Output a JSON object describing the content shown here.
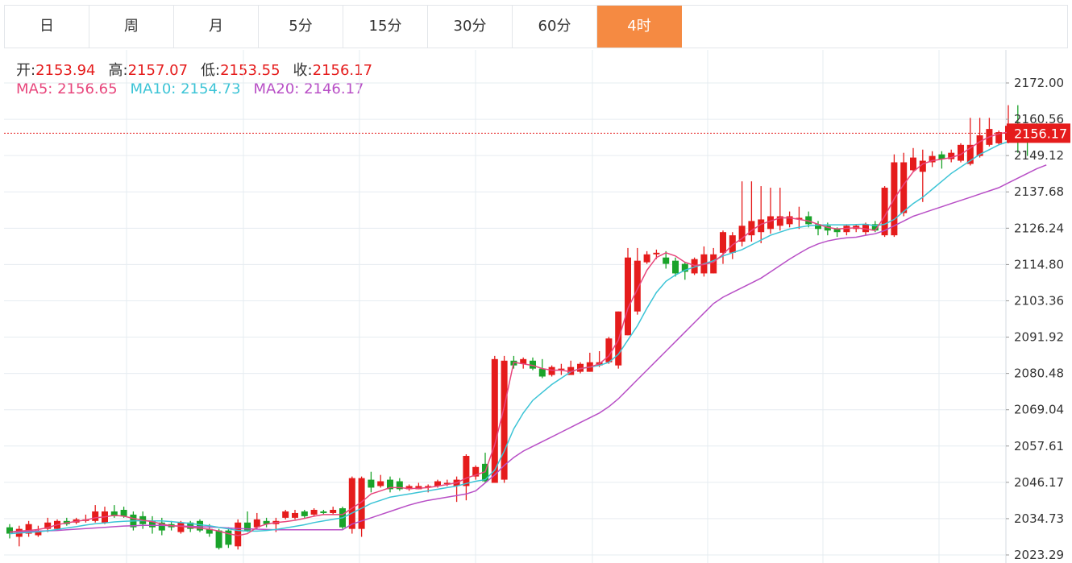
{
  "tabs": [
    "日",
    "周",
    "月",
    "5分",
    "15分",
    "30分",
    "60分",
    "4时"
  ],
  "active_tab": "4时",
  "ohlc": {
    "open_label": "开:",
    "open": "2153.94",
    "high_label": "高:",
    "high": "2157.07",
    "low_label": "低:",
    "low": "2153.55",
    "close_label": "收:",
    "close": "2156.17"
  },
  "ma": {
    "ma5_label": "MA5:",
    "ma5": "2156.65",
    "ma10_label": "MA10:",
    "ma10": "2154.73",
    "ma20_label": "MA20:",
    "ma20": "2146.17"
  },
  "current_price": "2156.17",
  "colors": {
    "up": "#e51c1c",
    "down": "#1aa32a",
    "ma5": "#e8467c",
    "ma10": "#3cc4d6",
    "ma20": "#b84fc6",
    "active_tab": "#f58a42",
    "grid": "#e6ecf1"
  },
  "chart_data": {
    "type": "candlestick",
    "y_ticks": [
      "2172.00",
      "2160.56",
      "2149.12",
      "2137.68",
      "2126.24",
      "2114.80",
      "2103.36",
      "2091.92",
      "2080.48",
      "2069.04",
      "2057.61",
      "2046.17",
      "2034.73",
      "2023.29"
    ],
    "ylim": [
      2023.29,
      2172.0
    ],
    "candles": [
      [
        2032.0,
        2030.0,
        2033.0,
        2028.5
      ],
      [
        2029.0,
        2031.5,
        2032.5,
        2026.0
      ],
      [
        2030.0,
        2033.0,
        2034.0,
        2029.0
      ],
      [
        2029.5,
        2031.0,
        2032.5,
        2029.0
      ],
      [
        2031.5,
        2033.5,
        2035.0,
        2030.5
      ],
      [
        2031.5,
        2034.0,
        2034.5,
        2031.0
      ],
      [
        2034.0,
        2033.0,
        2035.0,
        2032.5
      ],
      [
        2033.5,
        2034.5,
        2035.0,
        2033.0
      ],
      [
        2034.0,
        2034.5,
        2036.0,
        2033.5
      ],
      [
        2034.0,
        2037.0,
        2039.0,
        2033.5
      ],
      [
        2033.5,
        2037.0,
        2038.5,
        2033.0
      ],
      [
        2037.0,
        2035.5,
        2039.0,
        2035.0
      ],
      [
        2037.5,
        2035.5,
        2038.5,
        2035.0
      ],
      [
        2036.0,
        2032.0,
        2037.0,
        2031.0
      ],
      [
        2035.5,
        2033.0,
        2037.0,
        2031.5
      ],
      [
        2034.0,
        2032.0,
        2035.5,
        2030.0
      ],
      [
        2033.5,
        2031.0,
        2035.0,
        2029.5
      ],
      [
        2033.0,
        2032.0,
        2034.0,
        2031.0
      ],
      [
        2030.5,
        2033.5,
        2034.0,
        2030.0
      ],
      [
        2033.5,
        2031.5,
        2034.0,
        2030.5
      ],
      [
        2034.0,
        2031.0,
        2034.5,
        2030.5
      ],
      [
        2031.5,
        2030.0,
        2033.0,
        2029.0
      ],
      [
        2031.0,
        2025.5,
        2031.5,
        2025.0
      ],
      [
        2031.0,
        2026.5,
        2032.0,
        2025.5
      ],
      [
        2026.0,
        2033.5,
        2034.5,
        2025.0
      ],
      [
        2033.5,
        2031.0,
        2037.0,
        2030.5
      ],
      [
        2032.0,
        2034.5,
        2036.5,
        2031.5
      ],
      [
        2034.0,
        2033.0,
        2035.0,
        2032.0
      ],
      [
        2033.0,
        2034.0,
        2035.0,
        2030.5
      ],
      [
        2035.0,
        2037.0,
        2037.5,
        2034.5
      ],
      [
        2035.0,
        2036.5,
        2037.5,
        2034.5
      ],
      [
        2037.0,
        2035.5,
        2037.5,
        2035.0
      ],
      [
        2036.0,
        2037.5,
        2038.0,
        2035.5
      ],
      [
        2037.0,
        2036.5,
        2037.5,
        2036.0
      ],
      [
        2036.5,
        2037.5,
        2038.5,
        2036.0
      ],
      [
        2038.0,
        2032.0,
        2038.5,
        2031.5
      ],
      [
        2031.5,
        2047.5,
        2048.0,
        2030.0
      ],
      [
        2031.5,
        2047.5,
        2048.0,
        2029.0
      ],
      [
        2047.0,
        2044.5,
        2049.5,
        2043.0
      ],
      [
        2045.0,
        2046.5,
        2048.5,
        2044.5
      ],
      [
        2047.0,
        2044.0,
        2048.0,
        2043.0
      ],
      [
        2046.5,
        2044.0,
        2047.5,
        2043.5
      ],
      [
        2044.0,
        2045.0,
        2045.5,
        2043.5
      ],
      [
        2044.0,
        2045.0,
        2046.0,
        2044.0
      ],
      [
        2044.5,
        2045.0,
        2045.5,
        2043.0
      ],
      [
        2045.0,
        2046.5,
        2047.0,
        2044.5
      ],
      [
        2046.0,
        2046.0,
        2047.0,
        2045.0
      ],
      [
        2045.0,
        2047.0,
        2048.0,
        2040.0
      ],
      [
        2045.0,
        2054.5,
        2055.0,
        2040.5
      ],
      [
        2048.0,
        2051.0,
        2051.5,
        2047.0
      ],
      [
        2052.0,
        2046.5,
        2055.5,
        2046.0
      ],
      [
        2046.0,
        2085.0,
        2086.0,
        2046.0
      ],
      [
        2047.0,
        2084.5,
        2086.0,
        2046.0
      ],
      [
        2084.5,
        2083.0,
        2086.0,
        2082.0
      ],
      [
        2083.5,
        2085.0,
        2085.5,
        2082.0
      ],
      [
        2084.5,
        2082.0,
        2085.5,
        2081.5
      ],
      [
        2082.0,
        2079.5,
        2085.0,
        2079.0
      ],
      [
        2080.0,
        2082.5,
        2083.0,
        2079.5
      ],
      [
        2082.0,
        2082.0,
        2083.5,
        2080.0
      ],
      [
        2080.0,
        2082.5,
        2084.5,
        2080.0
      ],
      [
        2081.0,
        2083.5,
        2084.0,
        2080.5
      ],
      [
        2081.0,
        2084.0,
        2087.0,
        2081.0
      ],
      [
        2083.0,
        2084.0,
        2087.5,
        2082.5
      ],
      [
        2084.0,
        2091.5,
        2092.0,
        2083.5
      ],
      [
        2083.0,
        2100.0,
        2100.0,
        2082.0
      ],
      [
        2092.5,
        2117.0,
        2120.0,
        2092.5
      ],
      [
        2100.0,
        2116.0,
        2120.0,
        2099.0
      ],
      [
        2115.5,
        2118.0,
        2119.0,
        2115.0
      ],
      [
        2118.0,
        2118.5,
        2119.5,
        2116.5
      ],
      [
        2117.0,
        2115.0,
        2119.0,
        2113.5
      ],
      [
        2116.0,
        2112.0,
        2117.0,
        2111.0
      ],
      [
        2115.0,
        2112.5,
        2115.5,
        2110.0
      ],
      [
        2112.0,
        2116.5,
        2117.0,
        2111.5
      ],
      [
        2112.0,
        2118.0,
        2120.5,
        2111.0
      ],
      [
        2112.0,
        2118.0,
        2120.0,
        2112.0
      ],
      [
        2118.5,
        2125.0,
        2125.5,
        2115.0
      ],
      [
        2118.5,
        2124.0,
        2125.0,
        2116.5
      ],
      [
        2122.0,
        2127.0,
        2141.0,
        2120.5
      ],
      [
        2124.0,
        2128.5,
        2141.0,
        2122.0
      ],
      [
        2125.0,
        2129.0,
        2139.5,
        2121.5
      ],
      [
        2126.0,
        2130.0,
        2139.0,
        2124.5
      ],
      [
        2127.0,
        2130.0,
        2139.0,
        2125.5
      ],
      [
        2127.5,
        2130.0,
        2131.5,
        2126.5
      ],
      [
        2129.0,
        2129.5,
        2133.0,
        2126.0
      ],
      [
        2130.0,
        2127.5,
        2131.5,
        2126.5
      ],
      [
        2127.5,
        2126.0,
        2128.5,
        2124.0
      ],
      [
        2127.0,
        2125.5,
        2128.0,
        2124.0
      ],
      [
        2126.0,
        2125.0,
        2126.5,
        2123.5
      ],
      [
        2125.0,
        2127.0,
        2127.5,
        2124.0
      ],
      [
        2126.0,
        2127.0,
        2127.5,
        2125.0
      ],
      [
        2125.0,
        2127.5,
        2128.0,
        2124.0
      ],
      [
        2127.5,
        2125.5,
        2128.5,
        2125.0
      ],
      [
        2124.0,
        2139.0,
        2139.5,
        2123.5
      ],
      [
        2124.0,
        2147.0,
        2149.5,
        2123.5
      ],
      [
        2131.0,
        2147.0,
        2150.0,
        2130.0
      ],
      [
        2144.5,
        2148.5,
        2151.5,
        2144.0
      ],
      [
        2144.0,
        2147.5,
        2151.0,
        2134.5
      ],
      [
        2147.0,
        2149.0,
        2150.5,
        2145.5
      ],
      [
        2149.5,
        2148.0,
        2150.5,
        2145.0
      ],
      [
        2148.0,
        2150.0,
        2151.0,
        2147.0
      ],
      [
        2147.5,
        2152.5,
        2153.0,
        2147.0
      ],
      [
        2146.5,
        2152.5,
        2161.0,
        2146.0
      ],
      [
        2149.0,
        2155.5,
        2161.0,
        2148.5
      ],
      [
        2152.5,
        2157.5,
        2161.0,
        2152.0
      ],
      [
        2153.0,
        2156.5,
        2157.0,
        2152.5
      ],
      [
        2154.0,
        2158.5,
        2165.0,
        2153.0
      ],
      [
        2157.0,
        2154.0,
        2165.0,
        2150.0
      ],
      [
        2155.5,
        2154.5,
        2158.5,
        2149.0
      ],
      [
        2158.5,
        2156.5,
        2159.5,
        2154.0
      ],
      [
        2153.94,
        2156.17,
        2157.07,
        2153.55
      ]
    ],
    "ma5": [
      2030.5,
      2030.8,
      2031.0,
      2031.3,
      2031.9,
      2032.8,
      2033.4,
      2033.9,
      2034.3,
      2035.0,
      2035.3,
      2035.8,
      2035.5,
      2034.8,
      2034.2,
      2033.8,
      2033.0,
      2032.5,
      2032.3,
      2032.0,
      2031.7,
      2031.4,
      2030.8,
      2030.0,
      2029.4,
      2030.0,
      2032.0,
      2033.0,
      2033.5,
      2033.8,
      2034.2,
      2034.8,
      2035.5,
      2036.0,
      2036.0,
      2036.0,
      2038.0,
      2040.0,
      2042.5,
      2043.5,
      2044.5,
      2044.5,
      2044.2,
      2044.3,
      2044.5,
      2045.0,
      2045.5,
      2046.0,
      2047.5,
      2048.5,
      2049.5,
      2058.0,
      2070.0,
      2084.0,
      2083.5,
      2083.0,
      2082.0,
      2081.5,
      2081.5,
      2081.0,
      2082.0,
      2082.5,
      2083.5,
      2086.0,
      2091.0,
      2101.0,
      2107.0,
      2113.0,
      2117.0,
      2118.5,
      2117.5,
      2115.5,
      2114.5,
      2114.8,
      2115.5,
      2118.0,
      2121.0,
      2123.0,
      2125.5,
      2127.5,
      2128.5,
      2129.5,
      2129.5,
      2129.0,
      2128.5,
      2127.5,
      2126.5,
      2126.0,
      2126.2,
      2126.4,
      2126.0,
      2125.5,
      2130.0,
      2135.5,
      2140.0,
      2144.0,
      2146.5,
      2147.5,
      2148.0,
      2148.5,
      2149.5,
      2151.5,
      2153.5,
      2155.0,
      2156.0,
      2156.5,
      2156.5,
      2156.5,
      2156.8,
      2156.65
    ],
    "ma10": [
      2030.0,
      2030.2,
      2030.4,
      2030.6,
      2030.9,
      2031.3,
      2031.8,
      2032.2,
      2032.7,
      2033.1,
      2033.4,
      2033.7,
      2033.9,
      2034.0,
      2034.1,
      2034.0,
      2034.0,
      2033.8,
      2033.5,
      2033.2,
      2032.8,
      2032.5,
      2032.0,
      2031.5,
      2031.0,
      2030.8,
      2030.8,
      2031.0,
      2031.3,
      2031.8,
      2032.3,
      2032.8,
      2033.5,
      2034.0,
      2034.5,
      2035.0,
      2036.5,
      2038.0,
      2039.5,
      2040.5,
      2041.5,
      2042.0,
      2042.5,
      2043.0,
      2043.5,
      2044.0,
      2044.5,
      2045.0,
      2045.8,
      2046.5,
      2047.0,
      2050.0,
      2056.0,
      2063.0,
      2068.0,
      2072.0,
      2074.5,
      2077.0,
      2079.0,
      2081.0,
      2082.0,
      2082.5,
      2083.0,
      2084.0,
      2086.5,
      2091.0,
      2095.5,
      2101.0,
      2106.0,
      2109.5,
      2111.5,
      2113.0,
      2114.0,
      2115.0,
      2116.0,
      2117.5,
      2118.5,
      2119.5,
      2121.0,
      2122.5,
      2124.0,
      2125.0,
      2126.0,
      2126.5,
      2127.0,
      2127.2,
      2127.3,
      2127.3,
      2127.3,
      2127.4,
      2127.5,
      2127.0,
      2127.5,
      2129.0,
      2131.5,
      2134.0,
      2136.0,
      2138.5,
      2141.0,
      2143.5,
      2145.5,
      2147.5,
      2149.5,
      2151.0,
      2152.5,
      2153.5,
      2154.0,
      2154.5,
      2155.0,
      2154.73
    ],
    "ma20": [
      2030.5,
      2030.6,
      2030.7,
      2030.8,
      2030.9,
      2031.0,
      2031.2,
      2031.4,
      2031.6,
      2031.8,
      2032.0,
      2032.2,
      2032.4,
      2032.5,
      2032.6,
      2032.6,
      2032.6,
      2032.5,
      2032.4,
      2032.3,
      2032.2,
      2032.1,
      2032.0,
      2031.8,
      2031.6,
      2031.5,
      2031.4,
      2031.3,
      2031.2,
      2031.2,
      2031.2,
      2031.2,
      2031.2,
      2031.2,
      2031.2,
      2031.2,
      2033.0,
      2034.0,
      2035.0,
      2036.0,
      2037.0,
      2038.0,
      2039.0,
      2039.8,
      2040.5,
      2041.0,
      2041.5,
      2042.0,
      2042.5,
      2043.5,
      2046.0,
      2048.5,
      2051.5,
      2054.0,
      2056.0,
      2057.5,
      2059.0,
      2060.5,
      2062.0,
      2063.5,
      2065.0,
      2066.5,
      2068.0,
      2070.0,
      2072.5,
      2075.5,
      2078.5,
      2081.5,
      2084.5,
      2087.5,
      2090.5,
      2093.5,
      2096.5,
      2099.5,
      2102.5,
      2104.5,
      2106.0,
      2107.5,
      2109.0,
      2110.5,
      2112.5,
      2114.5,
      2116.5,
      2118.3,
      2120.0,
      2121.3,
      2122.2,
      2122.8,
      2123.2,
      2123.4,
      2124.0,
      2124.5,
      2125.5,
      2127.0,
      2128.5,
      2130.0,
      2131.0,
      2132.0,
      2133.0,
      2134.0,
      2135.0,
      2136.0,
      2137.0,
      2138.0,
      2139.0,
      2140.5,
      2142.0,
      2143.5,
      2145.0,
      2146.17
    ]
  }
}
